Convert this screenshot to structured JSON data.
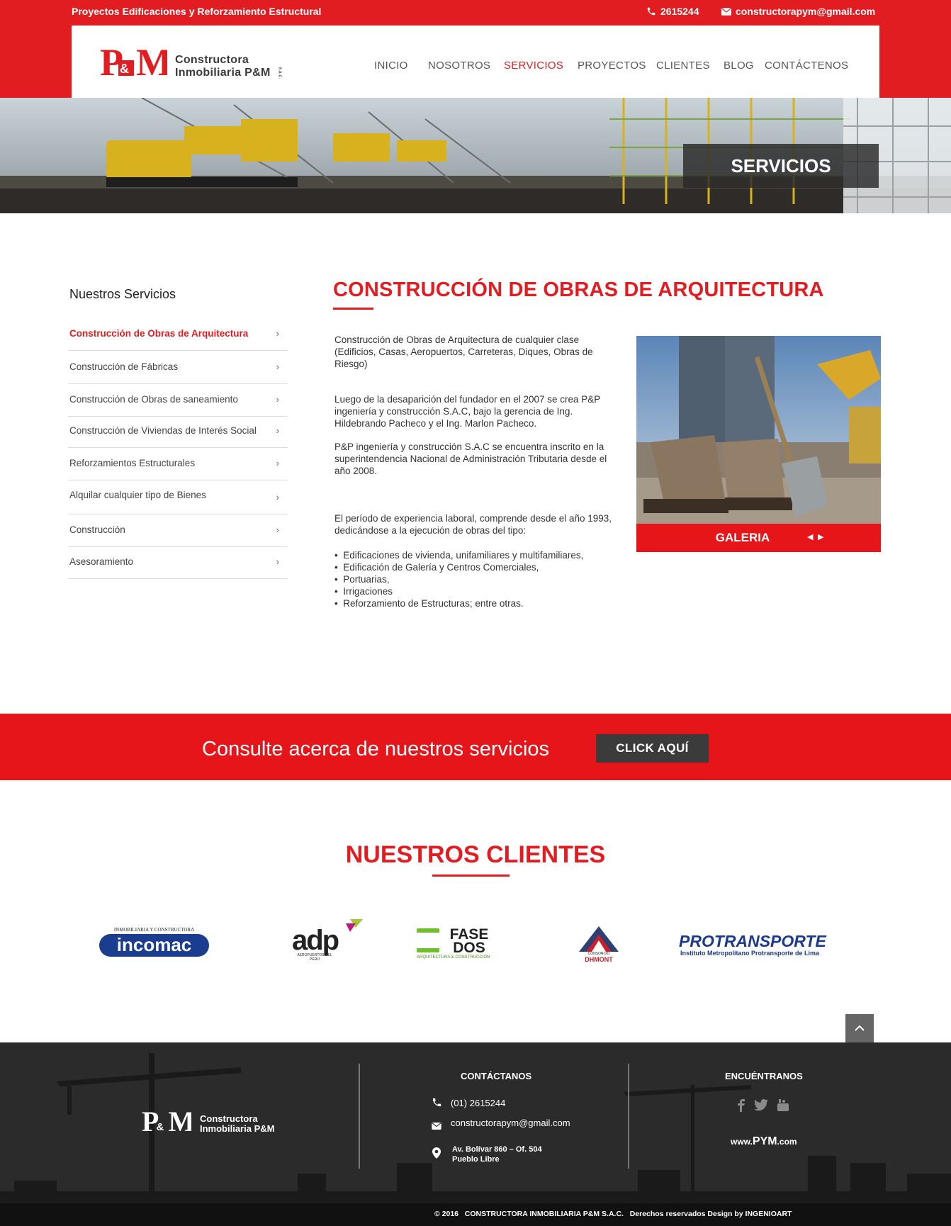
{
  "topbar": {
    "tagline": "Proyectos Edificaciones y Reforzamiento Estructural",
    "phone": "2615244",
    "email": "constructorapym@gmail.com",
    "background": "#e11d22"
  },
  "brand": {
    "logo_mark": "P&M",
    "name_line1": "Constructora",
    "name_line2": "Inmobiliaria P&M",
    "name_suffix": "S.A.C."
  },
  "nav": {
    "items": [
      {
        "label": "INICIO"
      },
      {
        "label": "NOSOTROS"
      },
      {
        "label": "SERVICIOS",
        "active": true
      },
      {
        "label": "PROYECTOS"
      },
      {
        "label": "CLIENTES"
      },
      {
        "label": "BLOG"
      },
      {
        "label": "CONTÁCTENOS"
      }
    ]
  },
  "hero": {
    "title": "SERVICIOS",
    "image": "construction-machinery-banner"
  },
  "sidebar": {
    "title": "Nuestros Servicios",
    "items": [
      {
        "label": "Construcción de Obras de Arquitectura",
        "active": true
      },
      {
        "label": "Construcción de Fábricas"
      },
      {
        "label": "Construcción de Obras de saneamiento"
      },
      {
        "label": "Construcción de Viviendas de Interés Social"
      },
      {
        "label": "Reforzamientos Estructurales"
      },
      {
        "label": "Alquilar cualquier tipo de Bienes"
      },
      {
        "label": "Construcción"
      },
      {
        "label": "Asesoramiento"
      }
    ],
    "chevron": "›"
  },
  "main": {
    "title": "CONSTRUCCIÓN DE OBRAS DE ARQUITECTURA",
    "paragraphs": [
      "Construcción de Obras de Arquitectura de cualquier clase (Edificios, Casas, Aeropuertos, Carreteras, Diques, Obras de Riesgo)",
      "Luego de la desaparición del fundador en el 2007 se crea P&P ingeniería y construcción S.A.C, bajo la gerencia de Ing. Hildebrando Pacheco y el Ing. Marlon Pacheco.",
      "P&P ingeniería y construcción S.A.C se encuentra inscrito en la superintendencia Nacional de Administración Tributaria desde el año 2008.",
      "El período de experiencia laboral, comprende desde el año 1993, dedicándose a la ejecución de obras del tipo:"
    ],
    "bullets": [
      "Edificaciones de vivienda, unifamiliares y multifamiliares,",
      "Edificación de Galería y Centros Comerciales,",
      "Portuarias,",
      "Irrigaciones",
      "Reforzamiento de Estructuras; entre otras."
    ],
    "gallery": {
      "label": "GALERIA",
      "prev": "◀",
      "next": "▶",
      "image": "worker-boots-shovel-photo"
    }
  },
  "cta": {
    "text": "Consulte acerca de nuestros servicios",
    "button": "CLICK AQUÍ",
    "background": "#e6151a"
  },
  "clients": {
    "title": "NUESTROS CLIENTES",
    "logos": [
      {
        "name": "incomac",
        "subtitle": "INMOBILIARIA Y CONSTRUCTORA"
      },
      {
        "name": "adp",
        "subtitle": "AEROPUERTOS DEL PERÚ"
      },
      {
        "name": "FASE DOS",
        "subtitle": "ARQUITECTURA & CONSTRUCCIÓN"
      },
      {
        "name": "DHMONT",
        "subtitle": "CONSORCIO"
      },
      {
        "name": "PROTRANSPORTE",
        "subtitle": "Instituto Metropolitano Protransporte de Lima"
      }
    ]
  },
  "footer": {
    "contact_heading": "CONTÁCTANOS",
    "phone": "(01) 2615244",
    "email": "constructorapym@gmail.com",
    "address_line1": "Av. Bolívar 860 – Of. 504",
    "address_line2": "Pueblo Libre",
    "find_heading": "ENCUÉNTRANOS",
    "social": [
      "facebook-icon",
      "twitter-icon",
      "youtube-icon"
    ],
    "website_pre": "www.",
    "website_main": "PYM",
    "website_post": ".com",
    "copyright": "© 2016   CONSTRUCTORA INMOBILIARIA P&M S.A.C.   Derechos reservados Design by INGENIOART"
  }
}
